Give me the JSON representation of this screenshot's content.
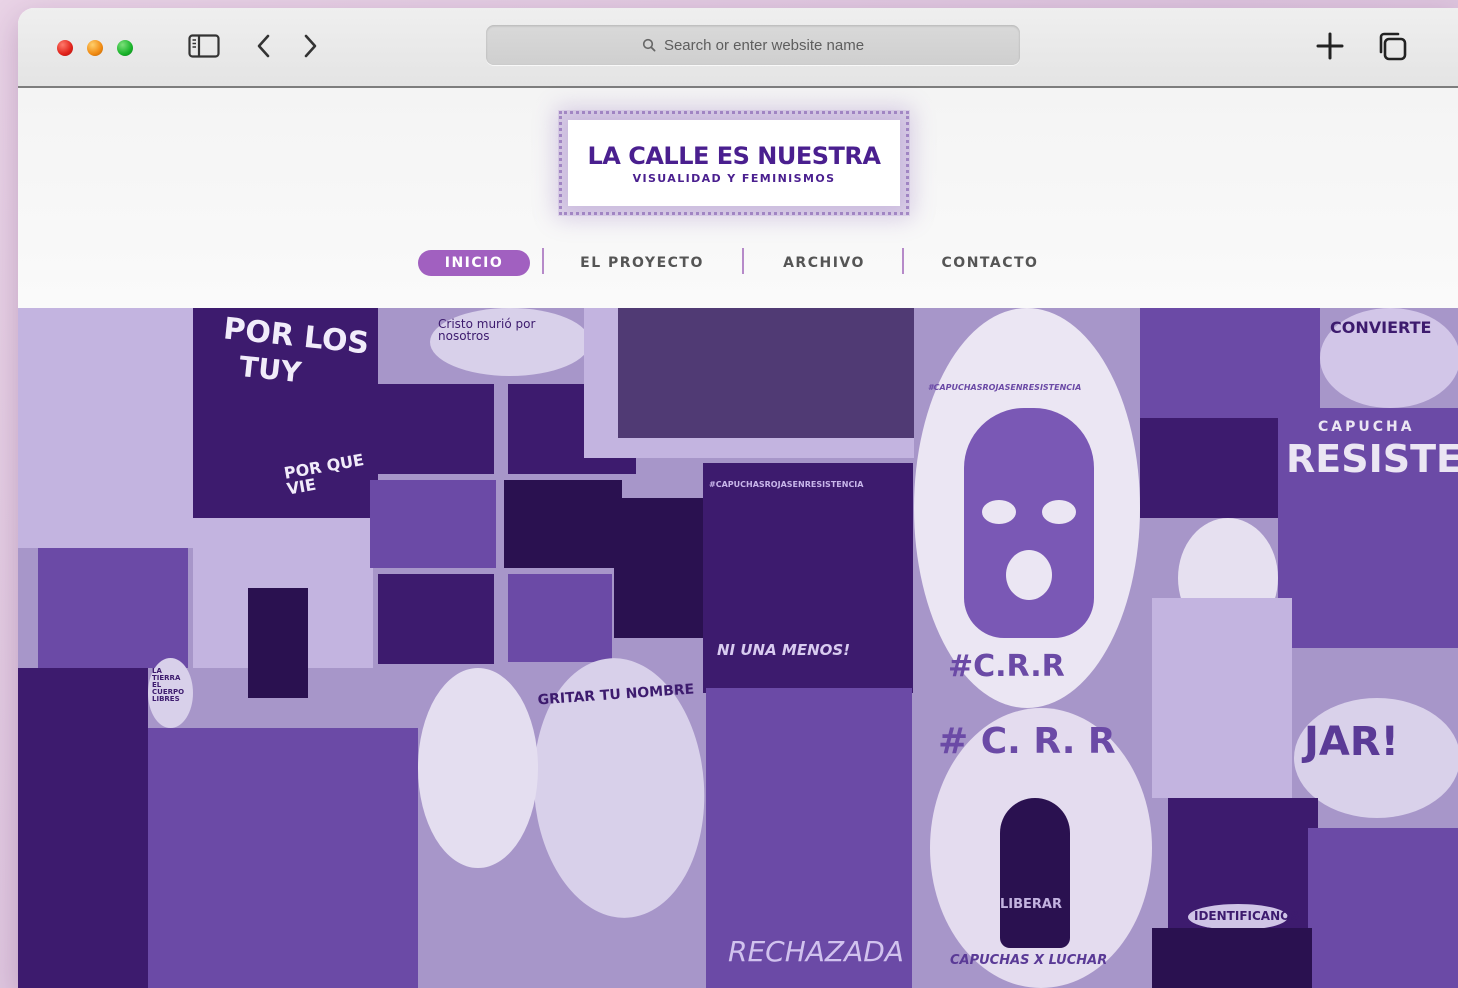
{
  "browser": {
    "address_placeholder": "Search or enter website name"
  },
  "site": {
    "logo_title": "LA CALLE ES NUESTRA",
    "logo_subtitle": "VISUALIDAD Y FEMINISMOS",
    "brand_color": "#4a1f8f",
    "accent_color": "#a160c0",
    "nav": [
      {
        "label": "INICIO",
        "active": true
      },
      {
        "label": "EL PROYECTO",
        "active": false
      },
      {
        "label": "ARCHIVO",
        "active": false
      },
      {
        "label": "CONTACTO",
        "active": false
      }
    ]
  },
  "hero": {
    "posters": {
      "por_los": "POR LOS",
      "tuyos": "TUY",
      "por_que_vie": "POR QUE VIE",
      "crr_1": "#C.R.R",
      "crr_2": "# C. R. R",
      "hashtag": "#CAPUCHASROJASENRESISTENCIA",
      "capucha": "CAPUCHA",
      "resiste": "RESISTE",
      "ni_una_menos": "NI UNA MENOS!",
      "gritar": "GRITAR TU NOMBRE",
      "rechazada": "RECHAZADA",
      "liberar": "LIBERAR",
      "capuchas_luchar": "CAPUCHAS X LUCHAR",
      "identificanos": "IDENTIFICANOS",
      "jar": "JAR!",
      "convierte": "CONVIERTE",
      "cristo": "Cristo murió por nosotros",
      "la_tierra": "LA TIERRA EL CUERPO LIBRES"
    }
  }
}
